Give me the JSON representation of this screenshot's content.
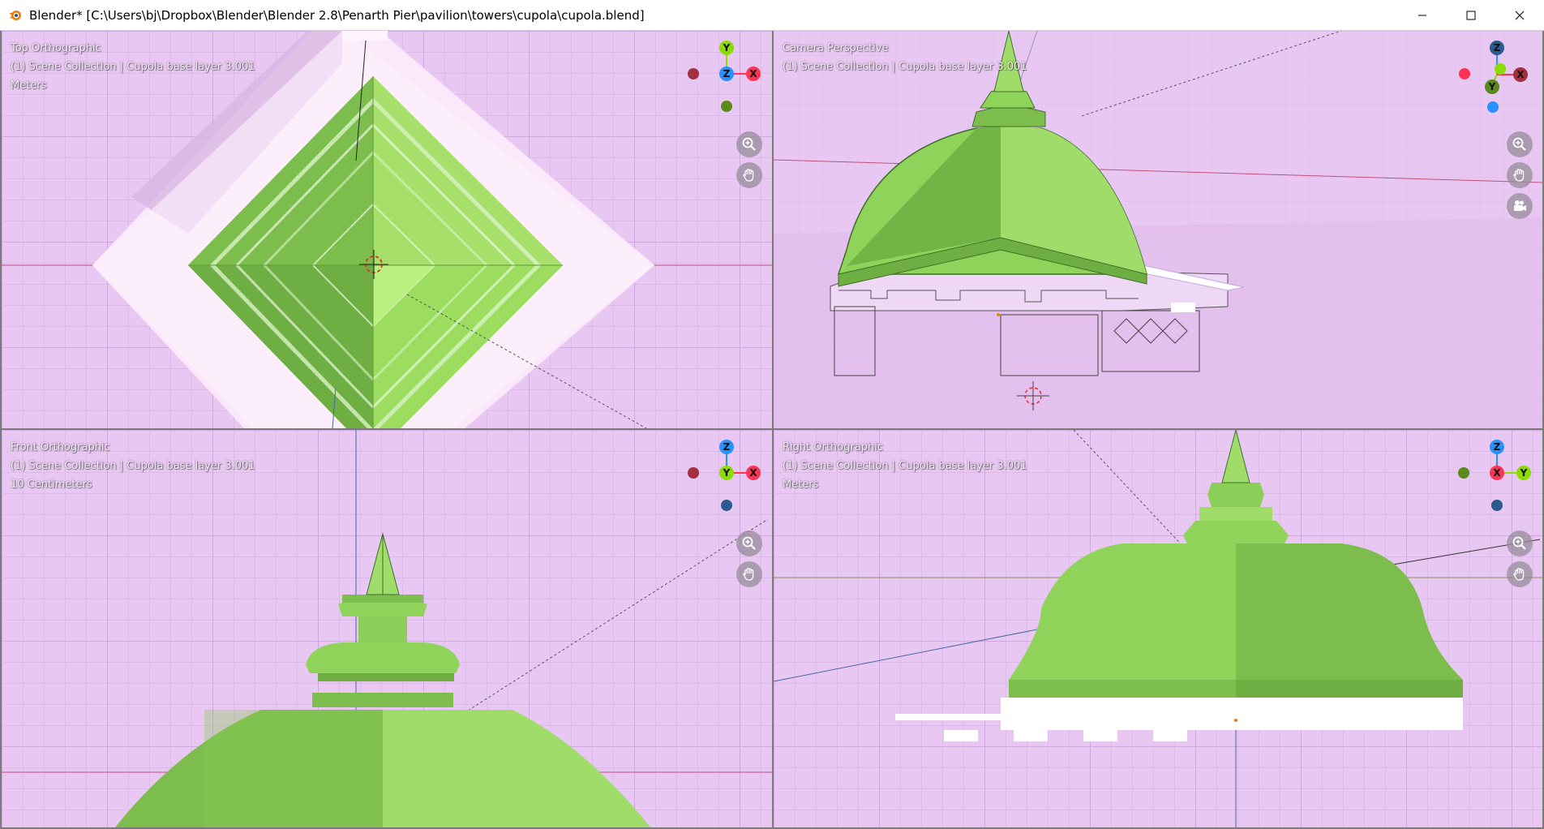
{
  "window": {
    "title": "Blender* [C:\\Users\\bj\\Dropbox\\Blender\\Blender 2.8\\Penarth Pier\\pavilion\\towers\\cupola\\cupola.blend]",
    "minimize_glyph": "—",
    "maximize_glyph": "☐",
    "close_glyph": "✕",
    "icon": "blender-logo-icon"
  },
  "viewports": {
    "top": {
      "view_name": "Top Orthographic",
      "collection": "(1) Scene Collection | Cupola base layer 3.001",
      "units": "Meters",
      "gizmo": {
        "up": "Y",
        "center": "Z",
        "right": "X"
      }
    },
    "camera": {
      "view_name": "Camera Perspective",
      "collection": "(1) Scene Collection | Cupola base layer 3.001",
      "gizmo": {
        "up": "Z",
        "center": "Y",
        "right": "X"
      }
    },
    "front": {
      "view_name": "Front Orthographic",
      "collection": "(1) Scene Collection | Cupola base layer 3.001",
      "units": "10 Centimeters",
      "gizmo": {
        "up": "Z",
        "center": "Y",
        "right": "X"
      }
    },
    "right": {
      "view_name": "Right Orthographic",
      "collection": "(1) Scene Collection | Cupola base layer 3.001",
      "units": "Meters",
      "gizmo": {
        "up": "Z",
        "center": "X",
        "right": "Y"
      }
    }
  },
  "colors": {
    "viewport_bg": "#e8c8f2",
    "axis_x": "#ff3352",
    "axis_y": "#8bdc00",
    "axis_z": "#2890ff",
    "dome_green": "#8fd35a",
    "dome_dark": "#6fae43"
  },
  "nav_icons": [
    "zoom-icon",
    "pan-hand-icon",
    "camera-icon"
  ]
}
